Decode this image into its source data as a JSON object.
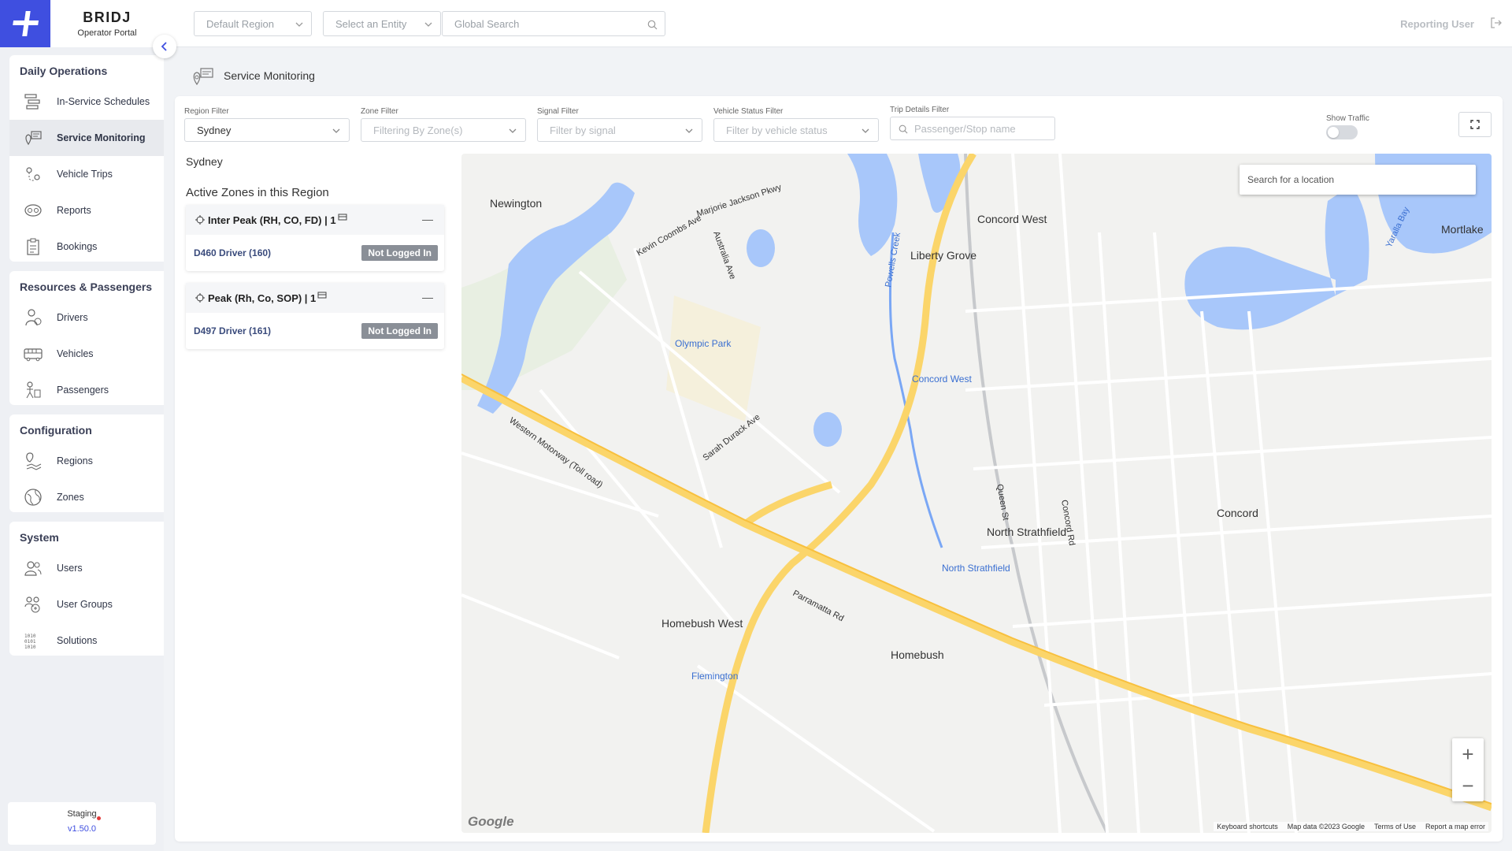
{
  "brand": {
    "name": "BRIDJ",
    "subtitle": "Operator Portal"
  },
  "sidebar": {
    "groups": [
      {
        "title": "Daily Operations",
        "items": [
          {
            "label": "In-Service Schedules",
            "icon": "schedule-icon"
          },
          {
            "label": "Service Monitoring",
            "icon": "monitoring-icon",
            "active": true
          },
          {
            "label": "Vehicle Trips",
            "icon": "route-pin-icon"
          },
          {
            "label": "Reports",
            "icon": "reports-icon"
          },
          {
            "label": "Bookings",
            "icon": "clipboard-icon"
          }
        ]
      },
      {
        "title": "Resources & Passengers",
        "items": [
          {
            "label": "Drivers",
            "icon": "driver-icon"
          },
          {
            "label": "Vehicles",
            "icon": "bus-icon"
          },
          {
            "label": "Passengers",
            "icon": "passenger-icon"
          }
        ]
      },
      {
        "title": "Configuration",
        "items": [
          {
            "label": "Regions",
            "icon": "region-icon"
          },
          {
            "label": "Zones",
            "icon": "globe-icon"
          }
        ]
      },
      {
        "title": "System",
        "items": [
          {
            "label": "Users",
            "icon": "users-icon"
          },
          {
            "label": "User Groups",
            "icon": "user-groups-icon"
          },
          {
            "label": "Solutions",
            "icon": "binary-icon"
          }
        ]
      }
    ],
    "environment": "Staging",
    "version": "v1.50.0"
  },
  "topbar": {
    "region_placeholder": "Default Region",
    "entity_placeholder": "Select an Entity",
    "search_placeholder": "Global Search",
    "user": "Reporting User"
  },
  "page": {
    "title": "Service Monitoring"
  },
  "filters": {
    "region": {
      "label": "Region Filter",
      "value": "Sydney"
    },
    "zone": {
      "label": "Zone Filter",
      "placeholder": "Filtering By Zone(s)"
    },
    "signal": {
      "label": "Signal Filter",
      "placeholder": "Filter by signal"
    },
    "vehicle_status": {
      "label": "Vehicle Status Filter",
      "placeholder": "Filter by vehicle status"
    },
    "trip_details": {
      "label": "Trip Details Filter",
      "placeholder": "Passenger/Stop name"
    },
    "show_traffic": {
      "label": "Show Traffic",
      "on": false
    }
  },
  "region_name": "Sydney",
  "zones_title": "Active Zones in this Region",
  "zones": [
    {
      "name": "Inter Peak (RH, CO, FD) | 1",
      "driver": "D460 Driver (160)",
      "status": "Not Logged In"
    },
    {
      "name": "Peak (Rh, Co, SOP) | 1",
      "driver": "D497 Driver (161)",
      "status": "Not Logged In"
    }
  ],
  "map": {
    "search_placeholder": "Search for a location",
    "footer": [
      "Keyboard shortcuts",
      "Map data ©2023 Google",
      "Terms of Use",
      "Report a map error"
    ],
    "labels": [
      {
        "text": "Newington",
        "cls": "place"
      },
      {
        "text": "Concord West",
        "cls": "place"
      },
      {
        "text": "Liberty Grove",
        "cls": "place"
      },
      {
        "text": "Mortlake",
        "cls": "place"
      },
      {
        "text": "North Strathfield",
        "cls": "place"
      },
      {
        "text": "Concord",
        "cls": "place"
      },
      {
        "text": "Homebush West",
        "cls": "place"
      },
      {
        "text": "Homebush",
        "cls": "place"
      },
      {
        "text": "Olympic Park",
        "cls": "poi"
      },
      {
        "text": "Concord West",
        "cls": "poi"
      },
      {
        "text": "North Strathfield",
        "cls": "poi"
      },
      {
        "text": "Flemington",
        "cls": "poi"
      },
      {
        "text": "Western Motorway (Toll road)",
        "cls": "road"
      },
      {
        "text": "Parramatta Rd",
        "cls": "road"
      },
      {
        "text": "Australia Ave",
        "cls": "road"
      },
      {
        "text": "Marjorie Jackson Pkwy",
        "cls": "road"
      },
      {
        "text": "Kevin Coombs Ave",
        "cls": "road"
      },
      {
        "text": "Sarah Durack Ave",
        "cls": "road"
      },
      {
        "text": "Queen St",
        "cls": "road"
      },
      {
        "text": "Concord Rd",
        "cls": "road"
      },
      {
        "text": "Yaralla Bay",
        "cls": "water"
      },
      {
        "text": "Powells Creek",
        "cls": "water"
      }
    ]
  }
}
